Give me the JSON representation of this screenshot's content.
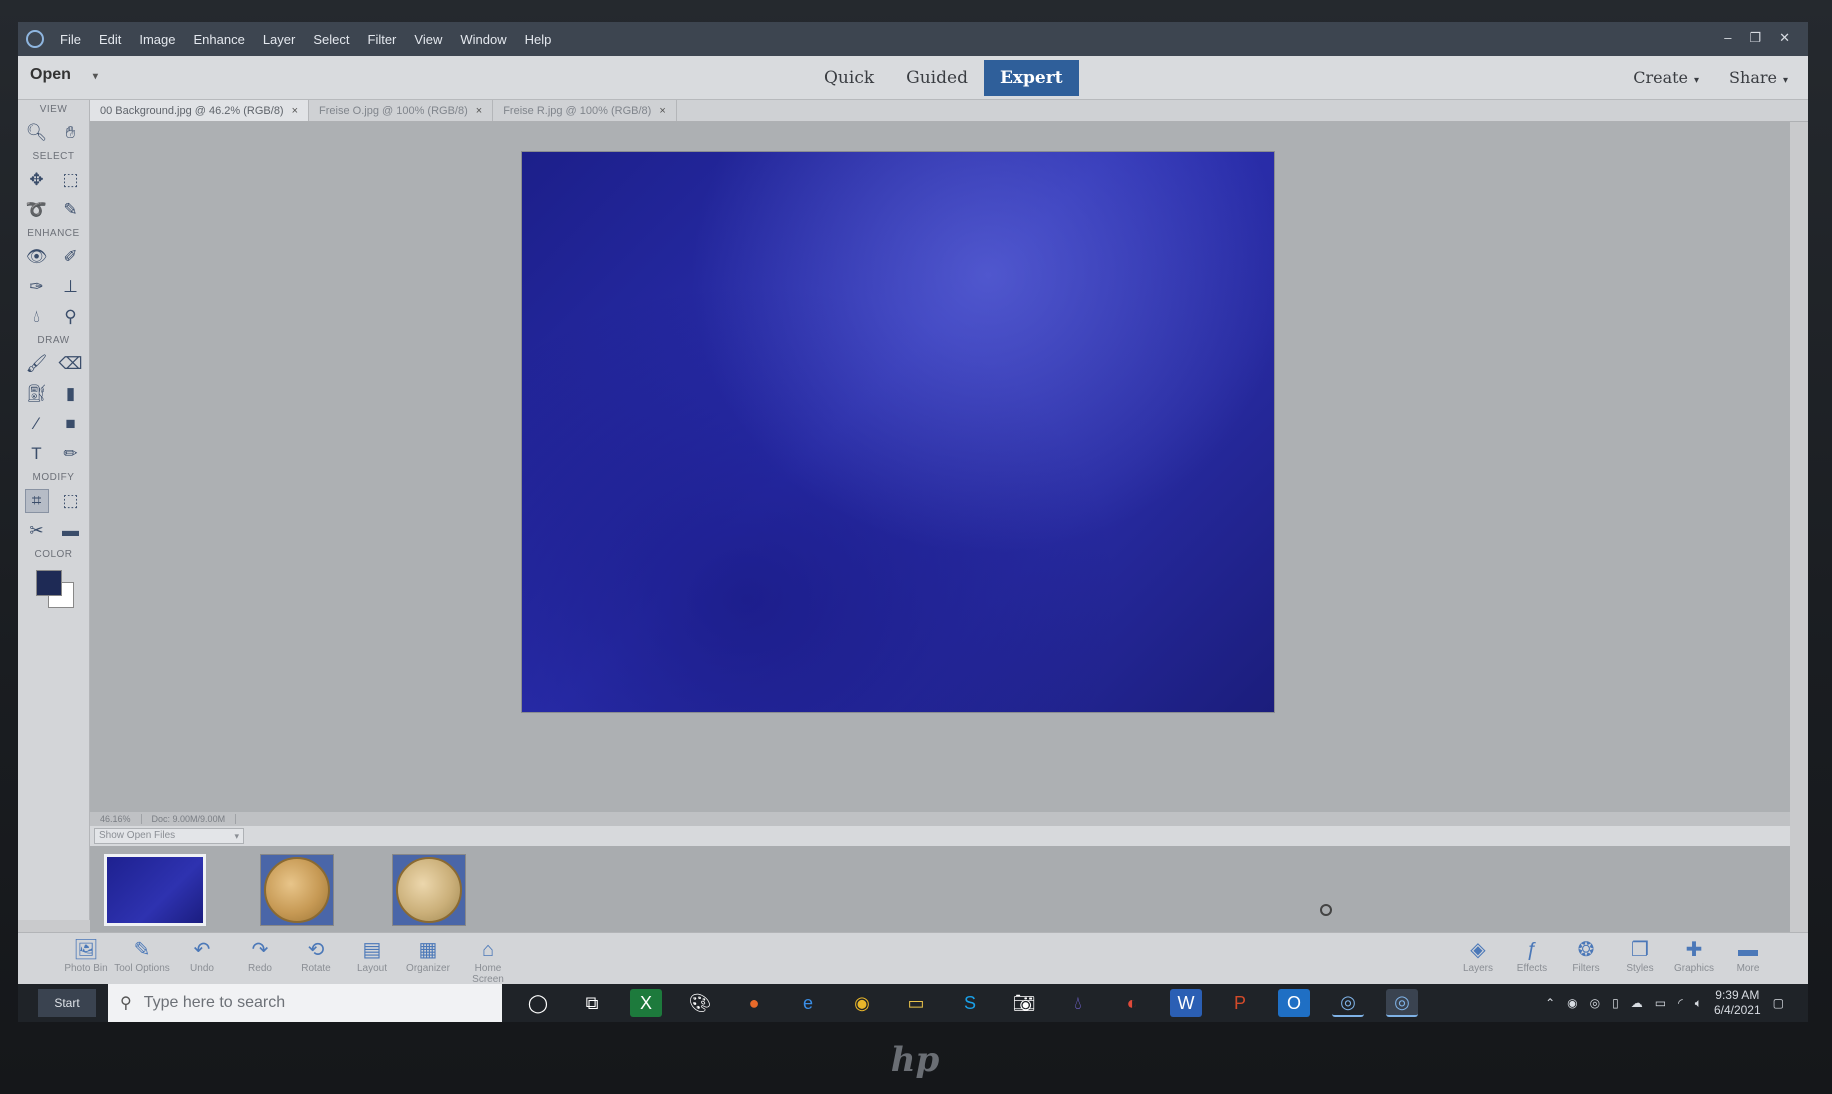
{
  "menubar": {
    "items": [
      "File",
      "Edit",
      "Image",
      "Enhance",
      "Layer",
      "Select",
      "Filter",
      "View",
      "Window",
      "Help"
    ],
    "window_controls": [
      "–",
      "❐",
      "✕"
    ]
  },
  "modebar": {
    "open_label": "Open",
    "tabs": [
      {
        "label": "Quick",
        "active": false
      },
      {
        "label": "Guided",
        "active": false
      },
      {
        "label": "Expert",
        "active": true
      }
    ],
    "create_label": "Create",
    "share_label": "Share"
  },
  "toolbox": {
    "sections": [
      "VIEW",
      "SELECT",
      "ENHANCE",
      "DRAW",
      "MODIFY",
      "COLOR"
    ],
    "foreground_color": "#1e2a55",
    "background_color": "#ffffff"
  },
  "doc_tabs": [
    {
      "label": "00 Background.jpg @ 46.2% (RGB/8)",
      "active": true
    },
    {
      "label": "Freise O.jpg @ 100% (RGB/8)",
      "active": false
    },
    {
      "label": "Freise R.jpg @ 100% (RGB/8)",
      "active": false
    }
  ],
  "statusbar": {
    "zoom": "46.16%",
    "doc_size": "Doc: 9.00M/9.00M"
  },
  "photo_bin": {
    "dropdown_value": "Show Open Files"
  },
  "actions_left": [
    {
      "label": "Photo Bin",
      "icon": "photo-bin-icon"
    },
    {
      "label": "Tool Options",
      "icon": "tool-options-icon"
    },
    {
      "label": "Undo",
      "icon": "undo-icon"
    },
    {
      "label": "Redo",
      "icon": "redo-icon"
    },
    {
      "label": "Rotate",
      "icon": "rotate-icon"
    },
    {
      "label": "Layout",
      "icon": "layout-icon"
    },
    {
      "label": "Organizer",
      "icon": "organizer-icon"
    },
    {
      "label": "Home Screen",
      "icon": "home-icon"
    }
  ],
  "actions_right": [
    {
      "label": "Layers",
      "icon": "layers-icon"
    },
    {
      "label": "Effects",
      "icon": "effects-icon"
    },
    {
      "label": "Filters",
      "icon": "filters-icon"
    },
    {
      "label": "Styles",
      "icon": "styles-icon"
    },
    {
      "label": "Graphics",
      "icon": "graphics-icon"
    },
    {
      "label": "More",
      "icon": "more-icon"
    }
  ],
  "taskbar": {
    "start_label": "Start",
    "search_placeholder": "Type here to search",
    "time": "9:39 AM",
    "date": "6/4/2021"
  }
}
